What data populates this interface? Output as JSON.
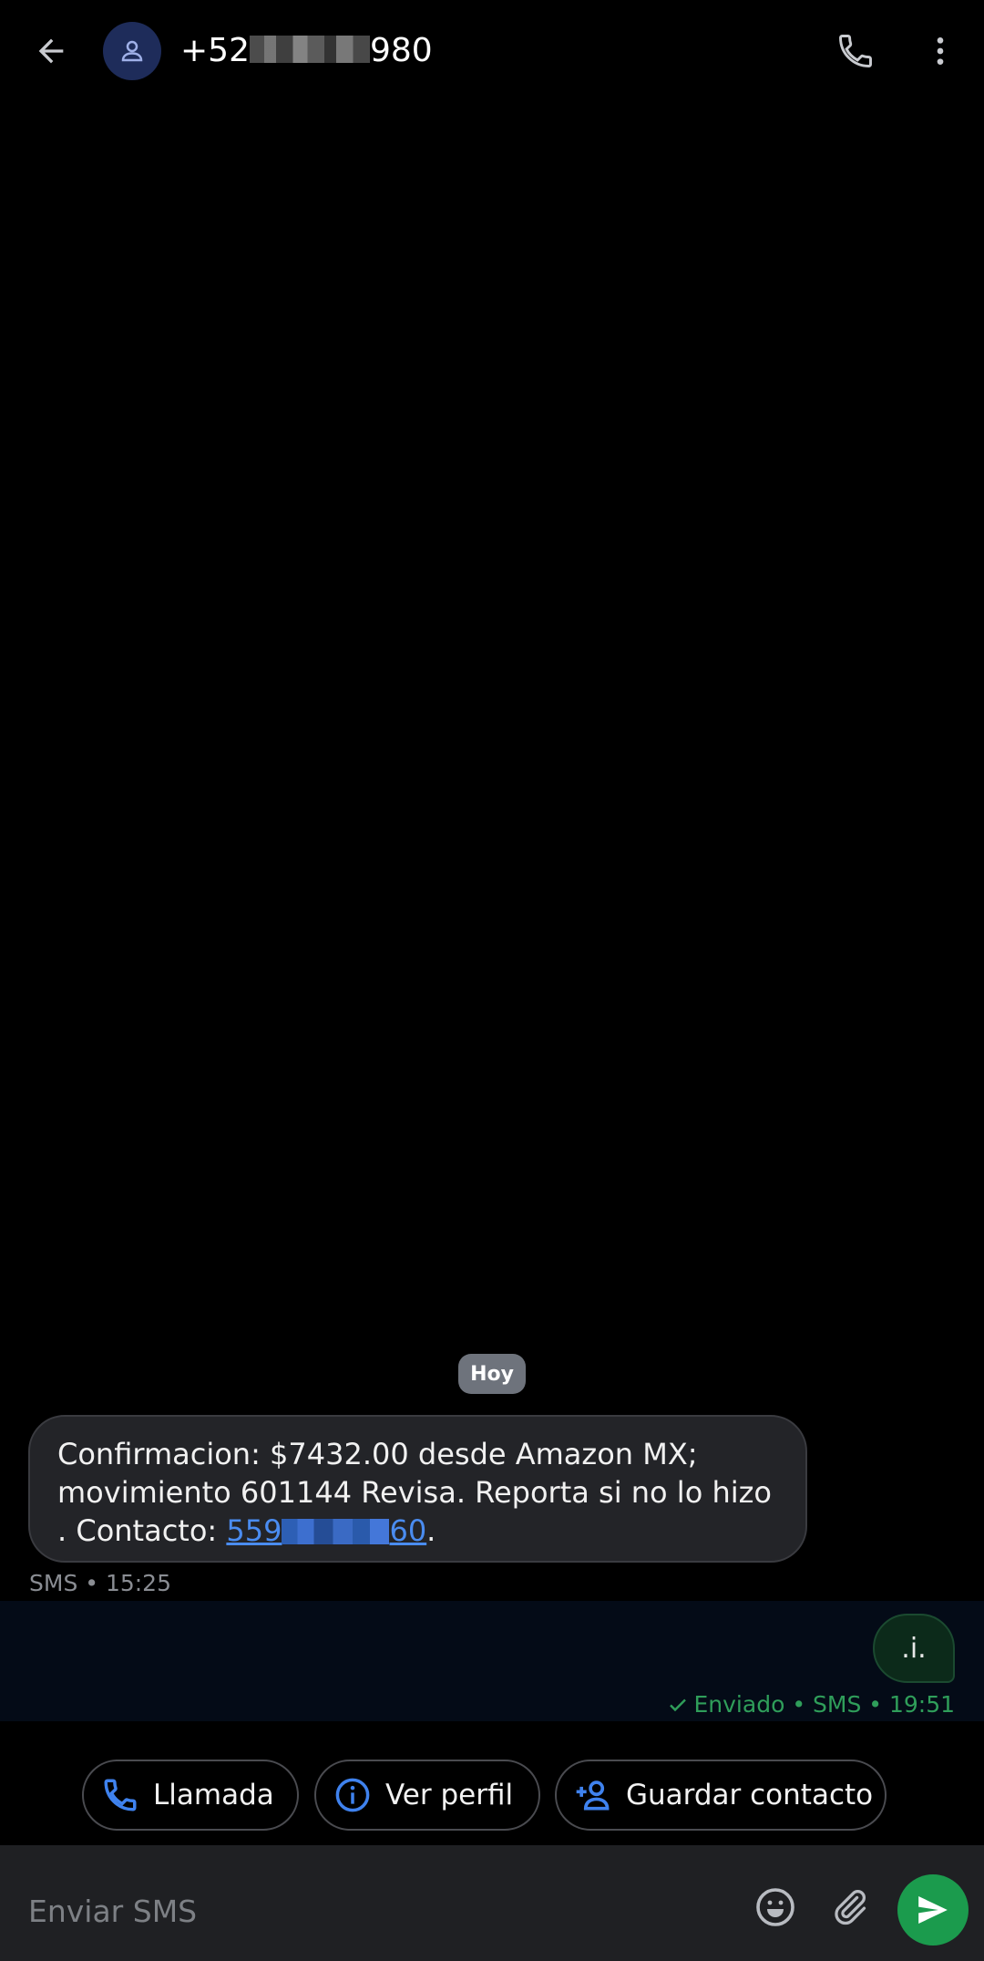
{
  "header": {
    "contact_prefix": "+52",
    "contact_suffix": "980",
    "icons": {
      "back": "back-arrow-icon",
      "avatar": "person-icon",
      "call": "phone-icon",
      "more": "more-vertical-icon"
    }
  },
  "conversation": {
    "date_label": "Hoy",
    "incoming": {
      "text_before_link": "Confirmacion: $7432.00 desde Amazon MX; movimiento 601144 Revisa. Reporta si no lo hizo . Contacto: ",
      "link_prefix": "559",
      "link_suffix": "60",
      "text_after_link": ".",
      "meta": "SMS • 15:25"
    },
    "outgoing": {
      "text": ".i.",
      "status_icon": "check-icon",
      "meta": "Enviado • SMS • 19:51"
    }
  },
  "suggestions": [
    {
      "label": "Llamada",
      "icon": "phone-icon"
    },
    {
      "label": "Ver perfil",
      "icon": "info-icon"
    },
    {
      "label": "Guardar contacto",
      "icon": "add-person-icon"
    }
  ],
  "composer": {
    "placeholder": "Enviar SMS",
    "icons": {
      "emoji": "emoji-icon",
      "attach": "paperclip-icon",
      "send": "send-icon"
    }
  },
  "colors": {
    "accent_blue": "#4a8cf0",
    "send_green": "#1b9b4d",
    "sent_status_green": "#2f9e5a",
    "avatar_bg": "#1e2c5a"
  }
}
